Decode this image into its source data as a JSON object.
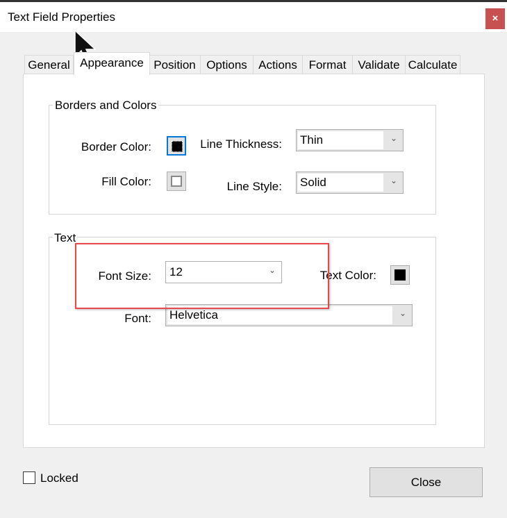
{
  "window": {
    "title": "Text Field Properties",
    "close_icon": "×"
  },
  "tabs": [
    "General",
    "Appearance",
    "Position",
    "Options",
    "Actions",
    "Format",
    "Validate",
    "Calculate"
  ],
  "active_tab": "Appearance",
  "borders": {
    "legend": "Borders and Colors",
    "border_color_label": "Border Color:",
    "border_color": "#000000",
    "fill_color_label": "Fill Color:",
    "fill_color": "#ffffff",
    "line_thickness_label": "Line Thickness:",
    "line_thickness": "Thin",
    "line_style_label": "Line Style:",
    "line_style": "Solid"
  },
  "text": {
    "legend": "Text",
    "font_size_label": "Font Size:",
    "font_size": "12",
    "text_color_label": "Text Color:",
    "text_color": "#000000",
    "font_label": "Font:",
    "font": "Helvetica"
  },
  "footer": {
    "locked_label": "Locked",
    "locked": false,
    "close_label": "Close"
  }
}
